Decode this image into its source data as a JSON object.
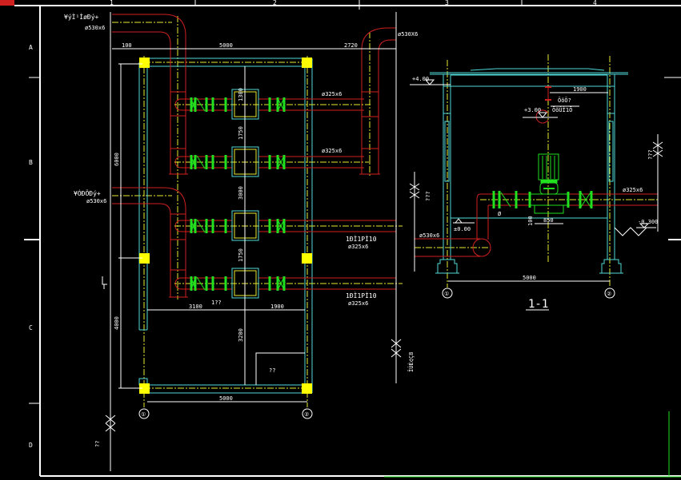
{
  "colors": {
    "background": "#000000",
    "frame": "#ffffff",
    "beam": "#4fd8d8",
    "pipe": "#d02020",
    "axis": "#e8e830",
    "valve": "#20e020",
    "column": "#ffff00"
  },
  "frame": {
    "columns": [
      "1",
      "2",
      "3",
      "4"
    ],
    "rows": [
      "A",
      "B",
      "C",
      "D"
    ]
  },
  "plan": {
    "inlet_top_label": "¥ýÌ¹ÌøÐý+",
    "inlet_top_size": "ø530x6",
    "inlet_bottom_label": "¥ÓÐÖÐý+",
    "inlet_bottom_size": "ø530x6",
    "outlet_top_size": "ø530X6",
    "branch_sizes": [
      "ø325x6",
      "ø325x6"
    ],
    "outlet_labels": [
      {
        "name": "1ÐÌ1PÌ10",
        "size": "ø325x6"
      },
      {
        "name": "1ÐÌ1PÌ10",
        "size": "ø325x6"
      }
    ],
    "dims_top": [
      "100",
      "5000",
      "2720"
    ],
    "dims_left": [
      "6000",
      "4000"
    ],
    "dims_center": [
      "1300",
      "1750",
      "3000",
      "1750",
      "3200"
    ],
    "dims_mid": [
      "3100",
      "1900"
    ],
    "mid_label": "1??",
    "room_label": "??",
    "dim_bottom": "5000",
    "axis_1": "①",
    "axis_2": "②",
    "side_note": "ÎÚÈ¢Ç8",
    "left_note": "??"
  },
  "section": {
    "title": "1-1",
    "elev_roof": "+4.00",
    "elev_crane": "+3.00",
    "elev_floor": "±0.00",
    "elev_ground": "-0.300",
    "dim_hook": "1900",
    "hook_label_1": "ÕõÕ?",
    "hook_label_2": "ÕõÛÌ1Õ",
    "outlet_size": "ø325x6",
    "inlet_size": "ø530x6",
    "pump_dim": "850",
    "pump_height": "100",
    "angle_label": "Ø",
    "dim_span": "5000",
    "axis_1": "①",
    "axis_2": "②",
    "side_note_left": "???",
    "side_note_right": "???"
  }
}
